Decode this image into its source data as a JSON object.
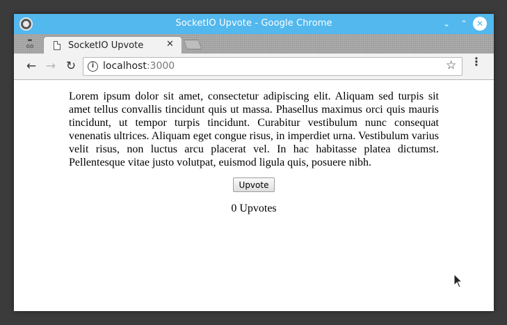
{
  "window": {
    "title": "SocketIO Upvote - Google Chrome",
    "controls": {
      "minimize": "⌄",
      "maximize": "⌃",
      "close": "✕"
    }
  },
  "browser": {
    "tab": {
      "title": "SocketIO Upvote",
      "close": "✕"
    },
    "incognito_label": "oo",
    "nav": {
      "back": "←",
      "forward": "→",
      "reload": "↻"
    },
    "address": {
      "host": "localhost",
      "port": ":3000",
      "info": "i"
    },
    "bookmark": "☆",
    "menu": "⋮"
  },
  "page": {
    "paragraph": "Lorem ipsum dolor sit amet, consectetur adipiscing elit. Aliquam sed turpis sit amet tellus convallis tincidunt quis ut massa. Phasellus maximus orci quis mauris tincidunt, ut tempor turpis tincidunt. Curabitur vestibulum nunc consequat venenatis ultrices. Aliquam eget congue risus, in imperdiet urna. Vestibulum varius velit risus, non luctus arcu placerat vel. In hac habitasse platea dictumst. Pellentesque vitae justo volutpat, euismod ligula quis, posuere nibh.",
    "upvote_button": "Upvote",
    "upvote_count": "0 Upvotes"
  },
  "colors": {
    "titlebar": "#52b8ee",
    "desktop": "#3b3b3b"
  }
}
